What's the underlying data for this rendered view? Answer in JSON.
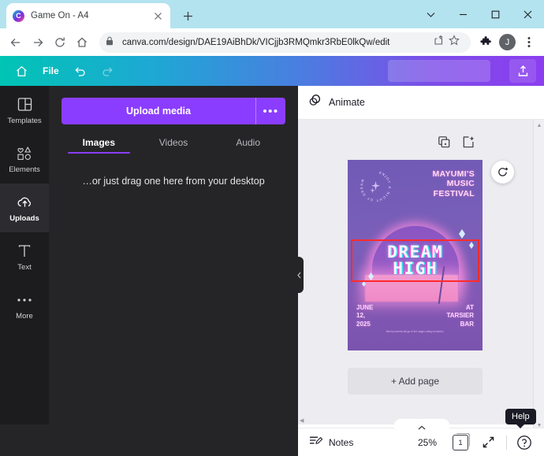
{
  "browser": {
    "tab": {
      "title": "Game On - A4",
      "favicon_letter": "C",
      "close_icon": "close-icon"
    },
    "new_tab_label": "+",
    "window_controls": [
      "chevron-down-icon",
      "minimize-icon",
      "maximize-icon",
      "close-icon"
    ],
    "nav": {
      "back": "back-icon",
      "forward": "forward-icon",
      "reload": "reload-icon",
      "home": "home-icon"
    },
    "omnibox": {
      "url": "canva.com/design/DAE19AiBhDk/VICjjb3RMQmkr3RbE0lkQw/edit",
      "lock_icon": "lock-icon",
      "share_icon": "share-icon",
      "star_icon": "star-icon"
    },
    "toolbar_icons": {
      "extensions": "puzzle-icon",
      "menu": "kebab-menu-icon"
    },
    "profile": {
      "initial": "J"
    }
  },
  "canva_topbar": {
    "home_icon": "home-icon",
    "file_label": "File",
    "undo_icon": "undo-icon",
    "redo_icon": "redo-icon",
    "export_icon": "share-export-icon",
    "gradient_start": "#00c4b4",
    "gradient_end": "#8b3ef0"
  },
  "sidebar": {
    "items": [
      {
        "label": "Templates",
        "icon": "templates-icon",
        "active": false
      },
      {
        "label": "Elements",
        "icon": "elements-icon",
        "active": false
      },
      {
        "label": "Uploads",
        "icon": "cloud-upload-icon",
        "active": true
      },
      {
        "label": "Text",
        "icon": "text-icon",
        "active": false
      },
      {
        "label": "More",
        "icon": "more-dots-icon",
        "active": false
      }
    ]
  },
  "uploads_panel": {
    "upload_button": "Upload media",
    "more_button": "•••",
    "tabs": [
      {
        "label": "Images",
        "active": true
      },
      {
        "label": "Videos",
        "active": false
      },
      {
        "label": "Audio",
        "active": false
      }
    ],
    "hint": "…or just drag one here from your desktop",
    "collapse_icon": "chevron-left-icon"
  },
  "editor": {
    "animate_label": "Animate",
    "animate_icon": "animate-circle-icon",
    "page_tools": [
      {
        "name": "duplicate-page-icon"
      },
      {
        "name": "add-page-icon"
      }
    ],
    "magic_button_icon": "magic-switch-icon",
    "add_page_label": "+ Add page"
  },
  "poster": {
    "badge_text": "ENJOY A NIGHT OF DREAM",
    "heading_lines": [
      "MAYUMI'S",
      "MUSIC",
      "FESTIVAL"
    ],
    "title_line1": "DREAM",
    "title_line2": "HIGH",
    "date_lines": [
      "JUNE",
      "12,",
      "2025"
    ],
    "venue_lines": [
      "AT",
      "TARSIER",
      "BAR"
    ],
    "fine_print": "titled proceeds will go to the magic colleg revolution.",
    "selection_color": "#ff2b2b",
    "bg_color": "#7a5fb8"
  },
  "statusbar": {
    "notes_label": "Notes",
    "notes_icon": "notes-icon",
    "zoom_level": "25%",
    "page_number": "1",
    "expand_icon": "expand-icon",
    "help_icon": "question-mark-icon",
    "help_tooltip": "Help",
    "caret_icon": "chevron-up-icon"
  }
}
